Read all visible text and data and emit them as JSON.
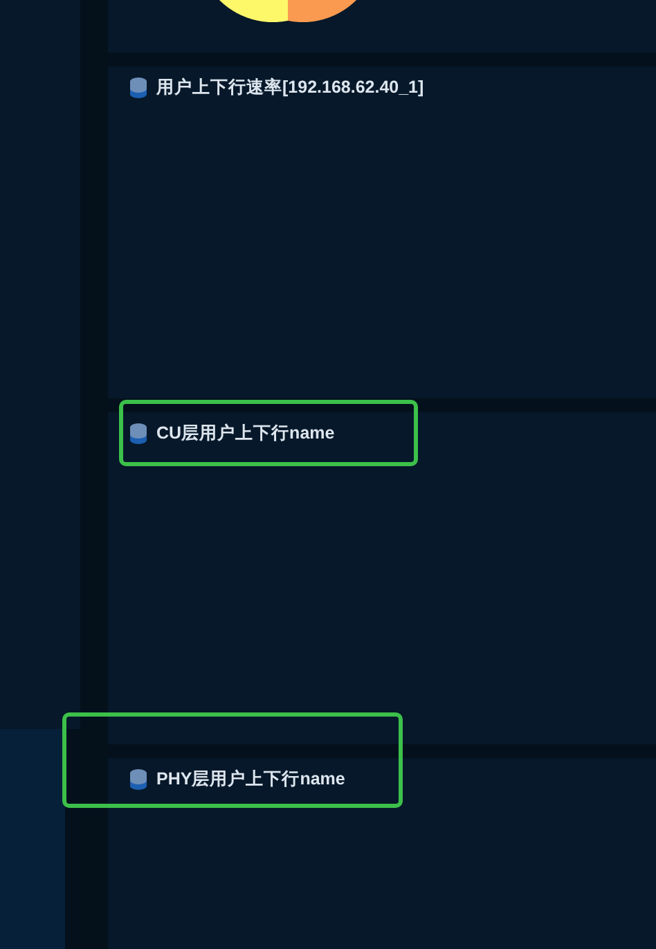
{
  "panels": [
    {
      "kind": "pie"
    },
    {
      "kind": "titled",
      "title": "用户上下行速率[192.168.62.40_1]",
      "highlighted": false
    },
    {
      "kind": "titled",
      "title": "CU层用户上下行name",
      "highlighted": true
    },
    {
      "kind": "titled",
      "title": "PHY层用户上下行name",
      "highlighted": true
    }
  ]
}
